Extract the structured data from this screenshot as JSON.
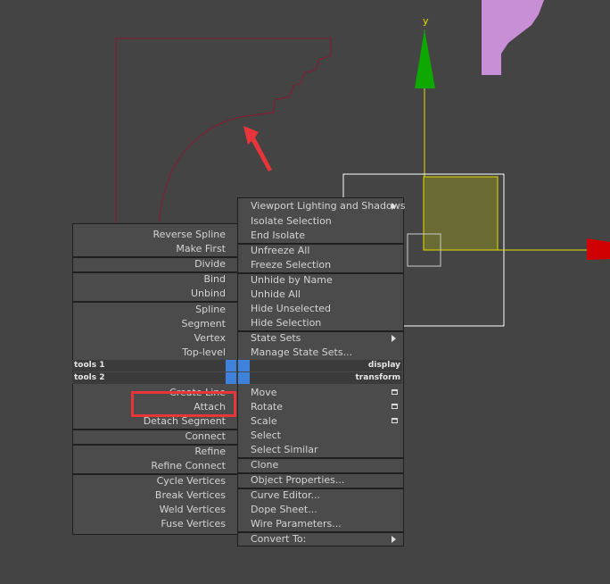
{
  "viewport": {
    "gizmo_y_label": "y",
    "colors": {
      "background": "#444444",
      "shape_outline": "#7a2337",
      "pink_object": "#c98fd6",
      "gizmo_y": "#0ea800",
      "gizmo_x": "#d00000",
      "gizmo_axis": "#e6dd00",
      "selection_box": "#ffffff",
      "annotation": "#e8353a"
    }
  },
  "quad_menu": {
    "left": {
      "items": [
        "Reverse Spline",
        "Make First",
        "Divide",
        "Bind",
        "Unbind",
        "Spline",
        "Segment",
        "Vertex",
        "Top-level",
        "Create Line",
        "Attach",
        "Detach Segment",
        "Connect",
        "Refine",
        "Refine Connect",
        "Cycle Vertices",
        "Break Vertices",
        "Weld Vertices",
        "Fuse Vertices"
      ],
      "checked_item_mark": "✓"
    },
    "right": {
      "items": [
        "Viewport Lighting and Shadows",
        "Isolate Selection",
        "End Isolate",
        "Unfreeze All",
        "Freeze Selection",
        "Unhide by Name",
        "Unhide All",
        "Hide Unselected",
        "Hide Selection",
        "State Sets",
        "Manage State Sets...",
        "Move",
        "Rotate",
        "Scale",
        "Select",
        "Select Similar",
        "Clone",
        "Object Properties...",
        "Curve Editor...",
        "Dope Sheet...",
        "Wire Parameters...",
        "Convert To:"
      ]
    },
    "headers": {
      "tools1": "tools 1",
      "tools2": "tools 2",
      "display": "display",
      "transform": "transform"
    }
  }
}
